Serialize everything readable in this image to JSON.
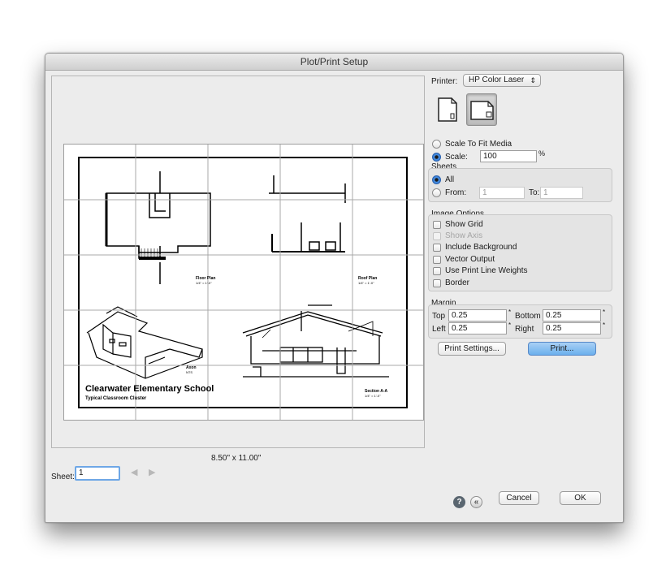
{
  "window": {
    "title": "Plot/Print Setup"
  },
  "preview": {
    "paper_size": "8.50\" x 11.00\"",
    "drawing": {
      "floor_plan_label": "Floor Plan",
      "floor_plan_scale": "1/4\" = 1'-0\"",
      "roof_plan_label": "Roof Plan",
      "roof_plan_scale": "1/4\" = 1'-0\"",
      "axon_label": "Axon",
      "axon_scale": "NTS",
      "section_label": "Section A-A",
      "section_scale": "1/4\" = 1'-0\"",
      "school_title": "Clearwater Elementary School",
      "school_subtitle": "Typical Classroom Cluster"
    }
  },
  "sheet": {
    "label": "Sheet:",
    "value": "1"
  },
  "printer": {
    "label": "Printer:",
    "selected": "HP Color Laser",
    "arrows": "⇕"
  },
  "scale": {
    "fit_label": "Scale To Fit Media",
    "scale_label": "Scale:",
    "scale_value": "100",
    "unit": "%",
    "selected": "scale"
  },
  "sheets": {
    "title": "Sheets",
    "all_label": "All",
    "from_label": "From:",
    "from_value": "1",
    "to_label": "To:",
    "to_value": "1",
    "selected": "all"
  },
  "image_options": {
    "title": "Image Options",
    "items": [
      {
        "label": "Show Grid",
        "checked": false,
        "enabled": true
      },
      {
        "label": "Show Axis",
        "checked": false,
        "enabled": false
      },
      {
        "label": "Include Background",
        "checked": false,
        "enabled": true
      },
      {
        "label": "Vector Output",
        "checked": false,
        "enabled": true
      },
      {
        "label": "Use Print Line Weights",
        "checked": false,
        "enabled": true
      },
      {
        "label": "Border",
        "checked": false,
        "enabled": true
      }
    ]
  },
  "margin": {
    "title": "Margin",
    "top_label": "Top",
    "top_value": "0.25",
    "bottom_label": "Bottom",
    "bottom_value": "0.25",
    "left_label": "Left",
    "left_value": "0.25",
    "right_label": "Right",
    "right_value": "0.25",
    "marker": "*"
  },
  "buttons": {
    "print_settings": "Print Settings...",
    "print": "Print...",
    "cancel": "Cancel",
    "ok": "OK",
    "help_glyph": "?",
    "back_glyph": "«",
    "prev_glyph": "◀",
    "next_glyph": "▶"
  },
  "colors": {
    "accent": "#6cb0ed",
    "window_bg": "#ececec",
    "help_icon": "#5a6670"
  },
  "icons": [
    "portrait-icon",
    "landscape-icon",
    "help-icon",
    "back-icon",
    "prev-sheet-icon",
    "next-sheet-icon"
  ]
}
